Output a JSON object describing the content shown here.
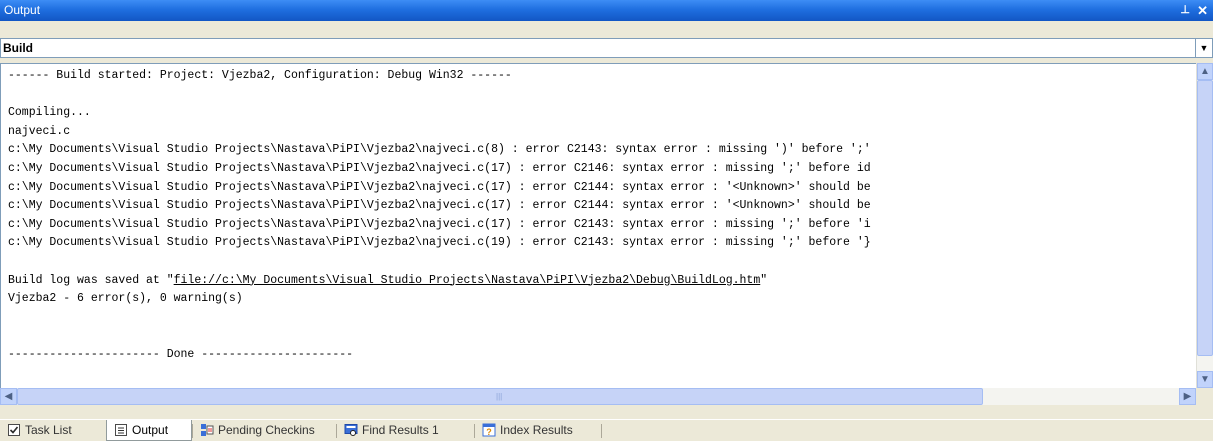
{
  "window": {
    "title": "Output",
    "pin_icon": "pin-icon",
    "close_icon": "close-icon"
  },
  "selector": {
    "value": "Build"
  },
  "output_lines": [
    "------ Build started: Project: Vjezba2, Configuration: Debug Win32 ------",
    "",
    "Compiling...",
    "najveci.c",
    "c:\\My Documents\\Visual Studio Projects\\Nastava\\PiPI\\Vjezba2\\najveci.c(8) : error C2143: syntax error : missing ')' before ';'",
    "c:\\My Documents\\Visual Studio Projects\\Nastava\\PiPI\\Vjezba2\\najveci.c(17) : error C2146: syntax error : missing ';' before id",
    "c:\\My Documents\\Visual Studio Projects\\Nastava\\PiPI\\Vjezba2\\najveci.c(17) : error C2144: syntax error : '<Unknown>' should be",
    "c:\\My Documents\\Visual Studio Projects\\Nastava\\PiPI\\Vjezba2\\najveci.c(17) : error C2144: syntax error : '<Unknown>' should be",
    "c:\\My Documents\\Visual Studio Projects\\Nastava\\PiPI\\Vjezba2\\najveci.c(17) : error C2143: syntax error : missing ';' before 'i",
    "c:\\My Documents\\Visual Studio Projects\\Nastava\\PiPI\\Vjezba2\\najveci.c(19) : error C2143: syntax error : missing ';' before '}",
    ""
  ],
  "build_log": {
    "prefix": "Build log was saved at \"",
    "link": "file://c:\\My Documents\\Visual Studio Projects\\Nastava\\PiPI\\Vjezba2\\Debug\\BuildLog.htm",
    "suffix": "\""
  },
  "summary_lines": [
    "Vjezba2 - 6 error(s), 0 warning(s)",
    "",
    "",
    "---------------------- Done ----------------------"
  ],
  "tabs": [
    {
      "label": "Task List",
      "icon": "task-list-icon",
      "active": false
    },
    {
      "label": "Output",
      "icon": "output-icon",
      "active": true
    },
    {
      "label": "Pending Checkins",
      "icon": "pending-checkins-icon",
      "active": false
    },
    {
      "label": "Find Results 1",
      "icon": "find-results-icon",
      "active": false
    },
    {
      "label": "Index Results",
      "icon": "index-results-icon",
      "active": false
    }
  ],
  "colors": {
    "title_bar": "#1f6fe0",
    "panel": "#ece9d8",
    "scroll": "#c1d3fb"
  }
}
